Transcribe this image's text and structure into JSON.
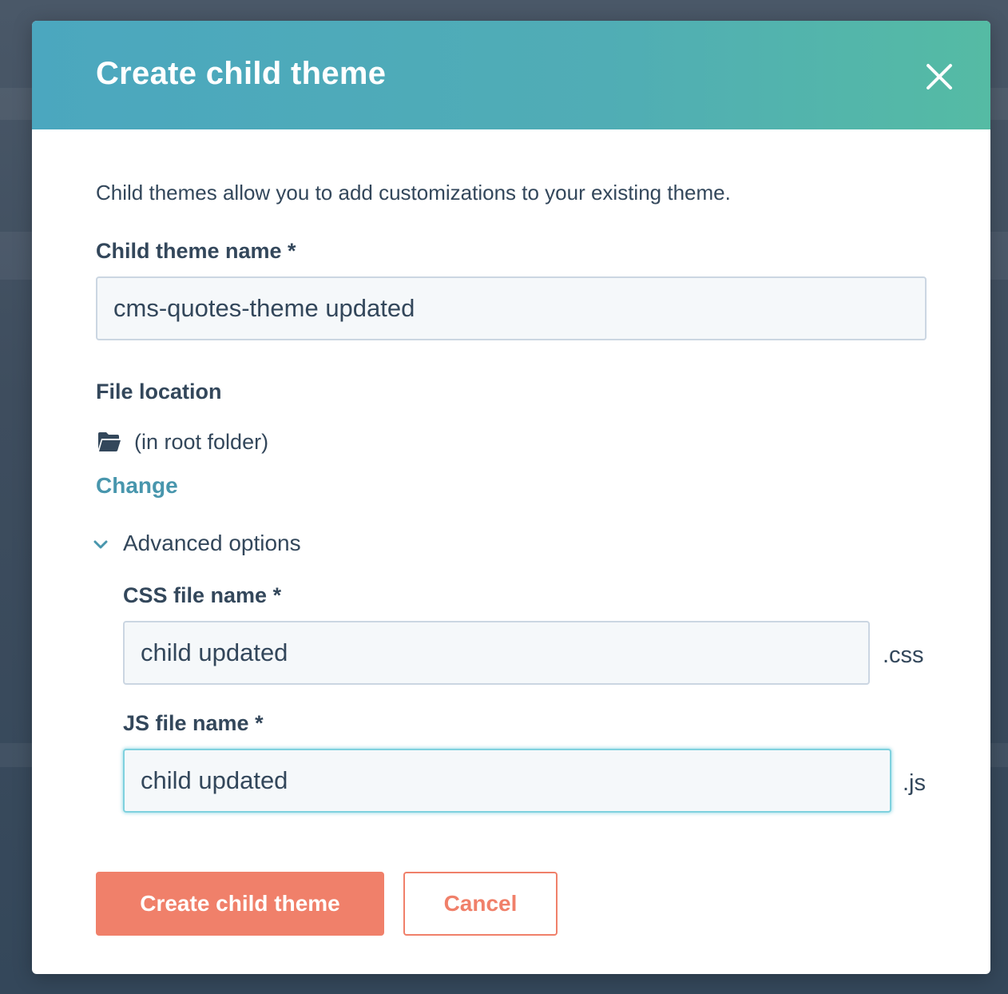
{
  "modal": {
    "title": "Create child theme",
    "description": "Child themes allow you to add customizations to your existing theme."
  },
  "child_theme_name": {
    "label": "Child theme name *",
    "value": "cms-quotes-theme updated"
  },
  "file_location": {
    "label": "File location",
    "folder_text": "(in root folder)",
    "change_link": "Change"
  },
  "advanced_options": {
    "label": "Advanced options",
    "expanded": true,
    "css": {
      "label": "CSS file name *",
      "value": "child updated",
      "suffix": ".css"
    },
    "js": {
      "label": "JS file name *",
      "value": "child updated",
      "suffix": ".js"
    }
  },
  "actions": {
    "create_label": "Create child theme",
    "cancel_label": "Cancel"
  },
  "icons": {
    "close": "close-icon",
    "folder": "folder-icon",
    "chevron": "chevron-down-icon"
  },
  "colors": {
    "header_gradient_start": "#4ba7bf",
    "header_gradient_end": "#55bba4",
    "primary": "#f0806a",
    "link": "#4896ad",
    "text": "#33475b",
    "input_focus": "#7fd1de"
  }
}
